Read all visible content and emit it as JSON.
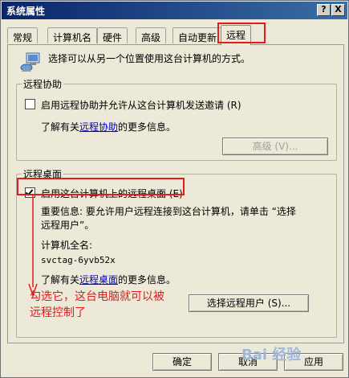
{
  "window": {
    "title": "系统属性",
    "help_button": "?",
    "close_button": "X"
  },
  "tabs": [
    {
      "label": "常规"
    },
    {
      "label": "计算机名"
    },
    {
      "label": "硬件"
    },
    {
      "label": "高级"
    },
    {
      "label": "自动更新"
    },
    {
      "label": "远程"
    }
  ],
  "intro_text": "选择可以从另一个位置使用这台计算机的方式。",
  "remote_assistance": {
    "title": "远程协助",
    "checkbox_label": "启用远程协助并允许从这台计算机发送邀请 (R)",
    "checked": false,
    "info_prefix": "了解有关",
    "info_link": "远程协助",
    "info_suffix": "的更多信息。",
    "advanced_button": "高级 (V)..."
  },
  "remote_desktop": {
    "title": "远程桌面",
    "checkbox_label": "启用这台计算机上的远程桌面 (E)",
    "checked": true,
    "important_line1": "重要信息: 要允许用户远程连接到这台计算机，请单击 “选择",
    "important_line2": "远程用户”。",
    "full_name_label": "计算机全名:",
    "full_name_value": "svctag-6yvb52x",
    "info_prefix": "了解有关",
    "info_link": "远程桌面",
    "info_suffix": "的更多信息。",
    "select_users_button": "选择远程用户 (S)..."
  },
  "annotation": {
    "line1": "勾选它，这台电脑就可以被",
    "line2": "远程控制了",
    "color": "#e21b1b"
  },
  "footer": {
    "ok_button": "确定",
    "cancel_button": "取消",
    "apply_button": "应用"
  },
  "watermark": "Bai 经验"
}
